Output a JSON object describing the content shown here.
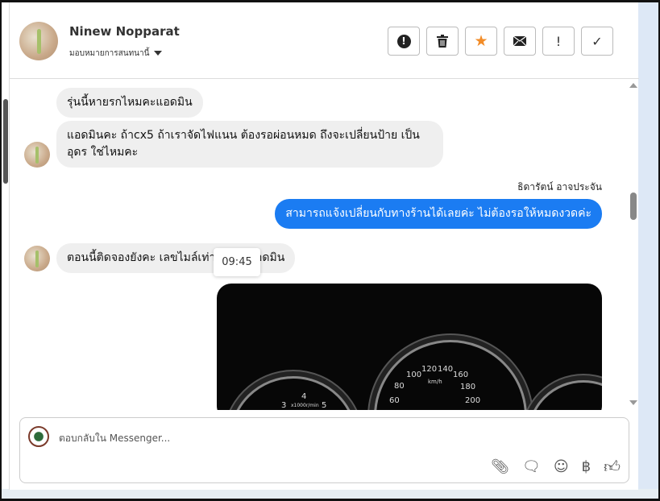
{
  "header": {
    "name": "Ninew Nopparat",
    "assign_label": "มอบหมายการสนทนานี้"
  },
  "actions": [
    {
      "name": "report-button",
      "icon": "alert-octagon-icon",
      "glyph": "●"
    },
    {
      "name": "delete-button",
      "icon": "trash-icon",
      "glyph": "🗑"
    },
    {
      "name": "star-button",
      "icon": "star-icon",
      "glyph": "★"
    },
    {
      "name": "mail-button",
      "icon": "envelope-icon",
      "glyph": "✉"
    },
    {
      "name": "important-button",
      "icon": "exclamation-icon",
      "glyph": "!"
    },
    {
      "name": "done-button",
      "icon": "check-icon",
      "glyph": "✓"
    }
  ],
  "messages": [
    {
      "text": "รุ่นนี้หายรกไหมคะแอดมิน"
    },
    {
      "text": "แอดมินคะ ถ้าcx5 ถ้าเราจัดไฟแนน ต้องรอผ่อนหมด ถึงจะเปลี่ยนป้าย เป็นอุดร ใช่ไหมคะ"
    },
    {
      "sender": "ธิดารัตน์ อาจประจัน",
      "text": "สามารถแจ้งเปลี่ยนกับทางร้านได้เลยค่ะ ไม่ต้องรอให้หมดงวดค่ะ"
    },
    {
      "text": "ตอนนี้ติดจองยังคะ เลขไมล์เท่าไหร่คะแอดมิน"
    }
  ],
  "tooltip_time": "09:45",
  "photo": {
    "tach": [
      "3",
      "4",
      "5"
    ],
    "tach_unit": "x1000r/min",
    "speed": [
      "60",
      "80",
      "100",
      "120",
      "140",
      "160",
      "180",
      "200"
    ],
    "speed_unit": "km/h"
  },
  "composer": {
    "placeholder": "ตอบกลับใน Messenger..."
  },
  "colors": {
    "accent": "#1b7cf2",
    "star": "#f28c28"
  }
}
